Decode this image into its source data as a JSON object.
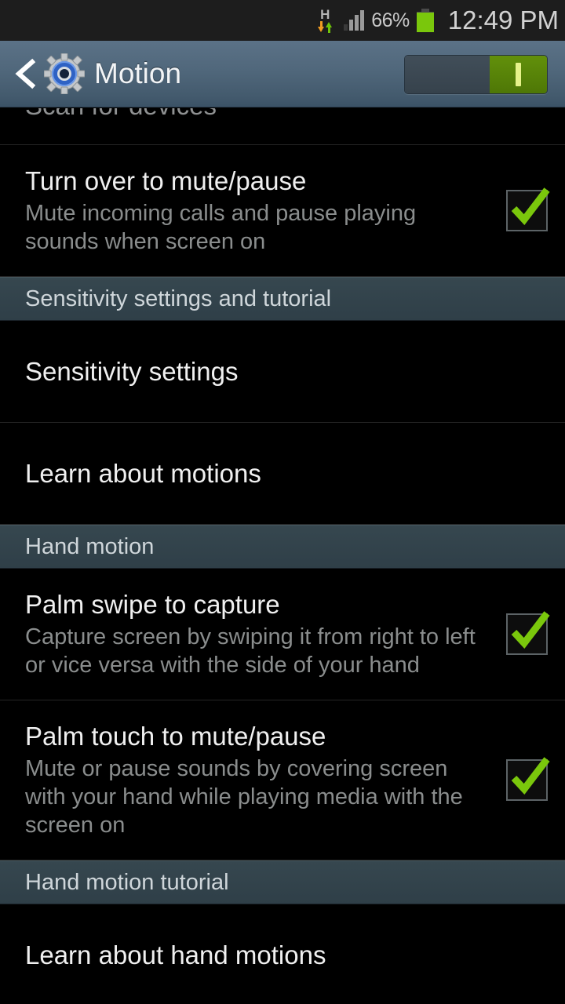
{
  "status_bar": {
    "network_type": "H",
    "data_down_icon": "arrow-down-icon",
    "data_up_icon": "arrow-up-icon",
    "signal_icon": "signal-bars-icon",
    "signal_bars_active": 3,
    "signal_bars_total": 4,
    "battery_percent_label": "66%",
    "battery_percent_value": 66,
    "battery_icon": "battery-icon",
    "clock": "12:49 PM"
  },
  "action_bar": {
    "back_icon": "back-chevron-icon",
    "app_icon": "settings-gear-icon",
    "title": "Motion",
    "master_switch": {
      "name": "motion-master-switch",
      "state": "on",
      "on_marker": "I"
    }
  },
  "colors": {
    "accent_green": "#7ac70c",
    "toggle_on": "#5a8509",
    "section_header_bg": "#32424a",
    "action_bar_bg": "#4d6478",
    "page_bg": "#000000",
    "title_text": "#f0f0f0",
    "subtitle_text": "#8a8d8d"
  },
  "list": [
    {
      "type": "item-clipped",
      "name": "list-item-scan-for-devices",
      "title": "Scan for devices",
      "subtitle": "",
      "has_checkbox": false
    },
    {
      "type": "item",
      "name": "list-item-turn-over-to-mute-pause",
      "title": "Turn over to mute/pause",
      "subtitle": "Mute incoming calls and pause playing sounds when screen on",
      "has_checkbox": true,
      "checked": true
    },
    {
      "type": "section",
      "name": "section-header-sensitivity-settings-and-tutorial",
      "title": "Sensitivity settings and tutorial"
    },
    {
      "type": "item-simple",
      "name": "list-item-sensitivity-settings",
      "title": "Sensitivity settings",
      "subtitle": "",
      "has_checkbox": false
    },
    {
      "type": "item-simple",
      "name": "list-item-learn-about-motions",
      "title": "Learn about motions",
      "subtitle": "",
      "has_checkbox": false
    },
    {
      "type": "section",
      "name": "section-header-hand-motion",
      "title": "Hand motion"
    },
    {
      "type": "item",
      "name": "list-item-palm-swipe-to-capture",
      "title": "Palm swipe to capture",
      "subtitle": "Capture screen by swiping it from right to left or vice versa with the side of your hand",
      "has_checkbox": true,
      "checked": true
    },
    {
      "type": "item",
      "name": "list-item-palm-touch-to-mute-pause",
      "title": "Palm touch to mute/pause",
      "subtitle": "Mute or pause sounds by covering screen with your hand while playing media with the screen on",
      "has_checkbox": true,
      "checked": true
    },
    {
      "type": "section",
      "name": "section-header-hand-motion-tutorial",
      "title": "Hand motion tutorial"
    },
    {
      "type": "item-simple",
      "name": "list-item-learn-about-hand-motions",
      "title": "Learn about hand motions",
      "subtitle": "",
      "has_checkbox": false
    }
  ]
}
